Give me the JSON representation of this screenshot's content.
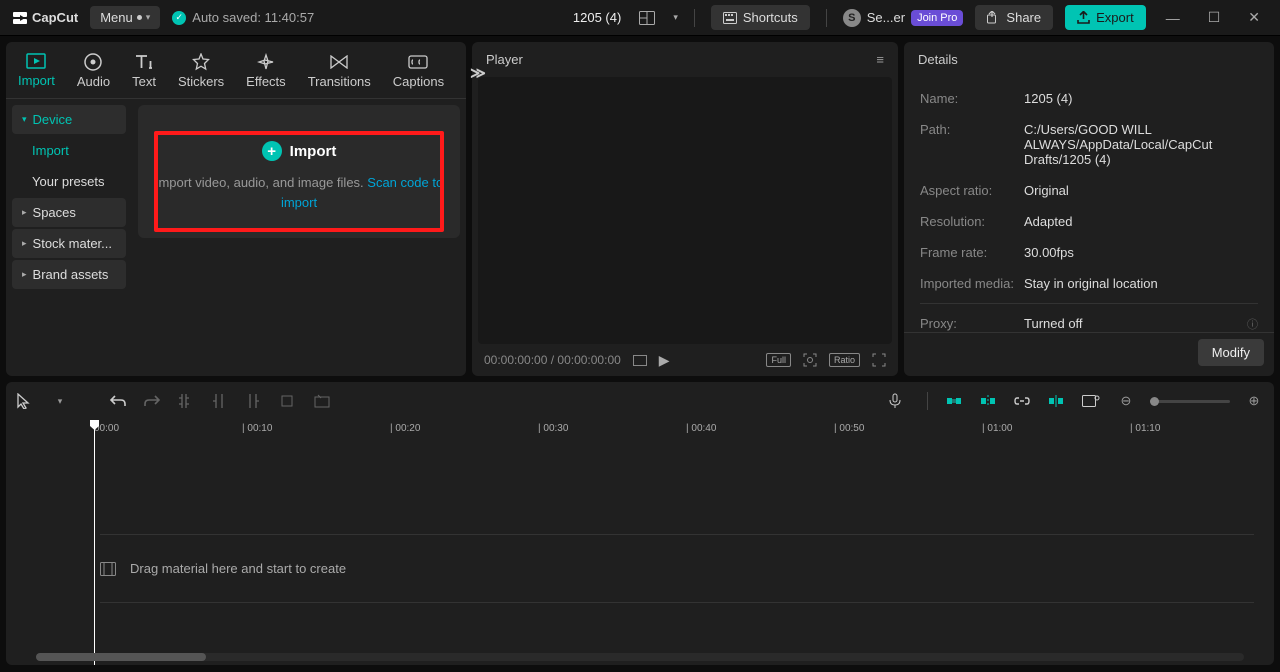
{
  "top": {
    "app": "CapCut",
    "menu": "Menu",
    "autosave": "Auto saved: 11:40:57",
    "docTitle": "1205 (4)",
    "shortcuts": "Shortcuts",
    "userShort": "Se...er",
    "userAvatar": "S",
    "joinPro": "Join Pro",
    "share": "Share",
    "export": "Export"
  },
  "tabs": {
    "import": "Import",
    "audio": "Audio",
    "text": "Text",
    "stickers": "Stickers",
    "effects": "Effects",
    "transitions": "Transitions",
    "captions": "Captions"
  },
  "filters": {
    "device": "Device",
    "import": "Import",
    "presets": "Your presets",
    "spaces": "Spaces",
    "stock": "Stock mater...",
    "brand": "Brand assets"
  },
  "importCard": {
    "title": "Import",
    "sub1": "Import video, audio, and image files. ",
    "sub2": "Scan code to import"
  },
  "player": {
    "title": "Player",
    "time": "00:00:00:00 / 00:00:00:00",
    "full": "Full",
    "ratio": "Ratio"
  },
  "details": {
    "title": "Details",
    "nameLab": "Name:",
    "nameVal": "1205 (4)",
    "pathLab": "Path:",
    "pathVal": "C:/Users/GOOD WILL ALWAYS/AppData/Local/CapCut Drafts/1205 (4)",
    "arLab": "Aspect ratio:",
    "arVal": "Original",
    "resLab": "Resolution:",
    "resVal": "Adapted",
    "frLab": "Frame rate:",
    "frVal": "30.00fps",
    "imLab": "Imported media:",
    "imVal": "Stay in original location",
    "pxLab": "Proxy:",
    "pxVal": "Turned off",
    "modify": "Modify"
  },
  "timeline": {
    "marks": [
      "00:00",
      "00:10",
      "00:20",
      "00:30",
      "00:40",
      "00:50",
      "01:00",
      "01:10"
    ],
    "dropText": "Drag material here and start to create"
  }
}
